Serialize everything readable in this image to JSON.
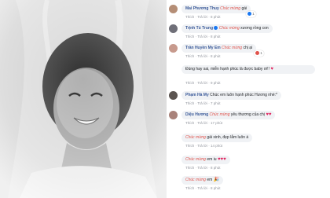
{
  "actions": {
    "like": "Thích",
    "reply": "Trả lời"
  },
  "keyword": "Chúc mừng",
  "comments": [
    {
      "name": "Mai Phương Thuy",
      "after": "gái",
      "time": "8 phút",
      "react_count": "1"
    },
    {
      "name": "Trịnh Tú Trung",
      "after": "xương rồng con",
      "time": "8 phút"
    },
    {
      "name": "Trần Huyền My Em",
      "after": "chị ại",
      "time": "8 phút",
      "react_count": "1"
    },
    {
      "name": "",
      "text": "Đúng hay sai, miễn hạnh phúc là được baby ơi!!",
      "time": "9 phút"
    },
    {
      "name": "Phạm Hà My",
      "text": "Chúc em luôn hạnh phúc Hương nhé:*",
      "time": "7 phút"
    },
    {
      "name": "Diệu Hương",
      "after": "yêu thương của chị",
      "time": "17 phút"
    },
    {
      "name": "",
      "after": "gái xinh, đẹp lắm luôn á",
      "time": "14 phút"
    },
    {
      "name": "",
      "after": "em iu",
      "time": "8 phút"
    },
    {
      "name": "",
      "after": "em",
      "time": "8 phút"
    }
  ]
}
